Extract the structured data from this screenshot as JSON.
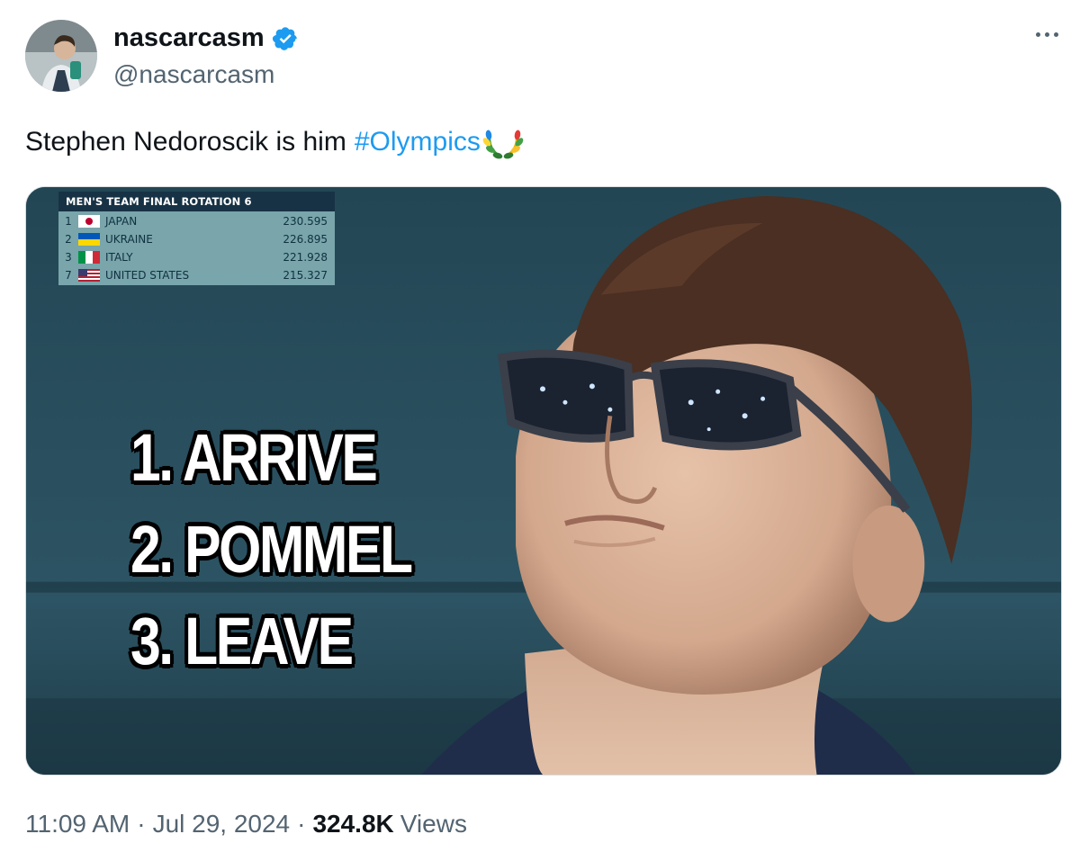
{
  "author": {
    "display_name": "nascarcasm",
    "handle": "@nascarcasm",
    "verified": true
  },
  "tweet": {
    "text": "Stephen Nedoroscik is him",
    "hashtag": "#Olympics",
    "hashtag_color": "#1d9bf0"
  },
  "media": {
    "scoreboard": {
      "title": "MEN'S TEAM FINAL  ROTATION 6",
      "rows": [
        {
          "rank": "1",
          "flag": "japan-flag",
          "country": "JAPAN",
          "score": "230.595"
        },
        {
          "rank": "2",
          "flag": "ukraine-flag",
          "country": "UKRAINE",
          "score": "226.895"
        },
        {
          "rank": "3",
          "flag": "italy-flag",
          "country": "ITALY",
          "score": "221.928"
        },
        {
          "rank": "7",
          "flag": "usa-flag",
          "country": "UNITED STATES",
          "score": "215.327"
        }
      ]
    },
    "caption_lines": [
      "1. ARRIVE",
      "2. POMMEL",
      "3. LEAVE"
    ]
  },
  "meta": {
    "time": "11:09 AM",
    "date": "Jul 29, 2024",
    "views_count": "324.8K",
    "views_label": "Views"
  },
  "icons": {
    "verified": "verified-badge-icon",
    "more": "more-options-icon",
    "laurel": "olympics-laurel-icon"
  }
}
